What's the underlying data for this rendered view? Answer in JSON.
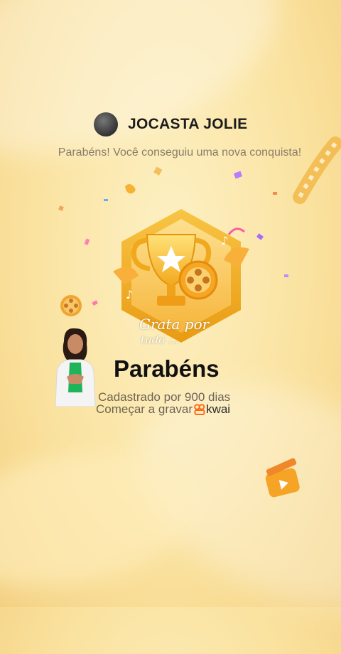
{
  "user": {
    "name": "JOCASTA JOLIE"
  },
  "subtitle": "Parabéns! Você conseguiu uma nova conquista!",
  "badge": {
    "script_line1": "Grata por",
    "script_line2": "tudo ..."
  },
  "main": {
    "title": "Parabéns",
    "registered": "Cadastrado por 900 dias",
    "start_recording": "Começar a gravar",
    "brand": "kwai"
  },
  "colors": {
    "badge_gold": "#f2b21f",
    "badge_inner": "#fbd36a",
    "kwai_orange": "#ff6a1a"
  }
}
